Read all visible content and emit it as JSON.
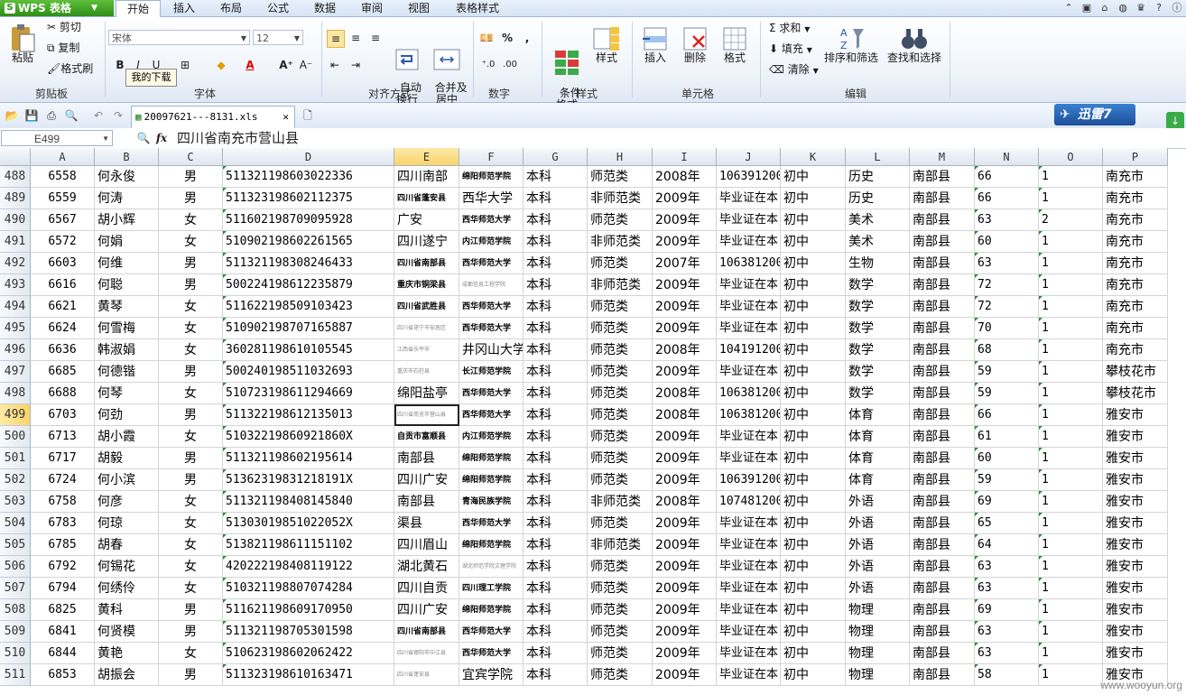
{
  "app": {
    "name": "WPS 表格"
  },
  "tabs": [
    "开始",
    "插入",
    "布局",
    "公式",
    "数据",
    "审阅",
    "视图",
    "表格样式"
  ],
  "ribbon": {
    "clipboard": {
      "paste": "粘贴",
      "cut": "剪切",
      "copy": "复制",
      "format_painter": "格式刷",
      "group": "剪贴板"
    },
    "font": {
      "name": "宋体",
      "size": "12",
      "group": "字体",
      "bold": "B",
      "italic": "I",
      "underline": "U",
      "grow": "A⁺",
      "shrink": "A⁻",
      "color_label": "A"
    },
    "align": {
      "wrap": "自动\n换行",
      "merge": "合并及\n居中",
      "group": "对齐方式"
    },
    "number": {
      "percent": "%",
      "comma": ",",
      "inc": "⁺.0",
      "dec": ".00",
      "group": "数字"
    },
    "styles": {
      "cond": "条件\n格式",
      "style": "样式",
      "group": "样式"
    },
    "cells": {
      "insert": "插入",
      "delete": "删除",
      "format": "格式",
      "group": "单元格"
    },
    "edit": {
      "sum": "求和",
      "fill": "填充",
      "clear": "清除",
      "sort": "排序和筛选",
      "find": "查找和选择",
      "group": "编辑"
    },
    "tooltip": "我的下载"
  },
  "doc": {
    "filename": "20097621---8131.xls"
  },
  "xunlei": "迅雷7",
  "formula": {
    "cell": "E499",
    "value": "四川省南充市营山县"
  },
  "columns": [
    "A",
    "B",
    "C",
    "D",
    "E",
    "F",
    "G",
    "H",
    "I",
    "J",
    "K",
    "L",
    "M",
    "N",
    "O",
    "P"
  ],
  "selected": {
    "row": 499,
    "col": "E"
  },
  "rows": [
    {
      "n": "488",
      "a": "6558",
      "b": "何永俊",
      "c": "男",
      "d": "511321198603022336",
      "e": "四川南部",
      "es": "n",
      "f": "绵阳师范学院",
      "fs": "t",
      "g": "本科",
      "h": "师范类",
      "i": "2008年",
      "j": "106391200",
      "k": "初中",
      "l": "历史",
      "m": "南部县",
      "nn": "66",
      "o": "1",
      "p": "南充市"
    },
    {
      "n": "489",
      "a": "6559",
      "b": "何涛",
      "c": "男",
      "d": "511323198602112375",
      "e": "四川省蓬安县",
      "es": "t",
      "f": "西华大学",
      "fs": "n",
      "g": "本科",
      "h": "非师范类",
      "i": "2009年",
      "j": "毕业证在本",
      "k": "初中",
      "l": "历史",
      "m": "南部县",
      "nn": "66",
      "o": "1",
      "p": "南充市"
    },
    {
      "n": "490",
      "a": "6567",
      "b": "胡小辉",
      "c": "女",
      "d": "511602198709095928",
      "e": "广安",
      "es": "n",
      "f": "西华师范大学",
      "fs": "t",
      "g": "本科",
      "h": "师范类",
      "i": "2009年",
      "j": "毕业证在本",
      "k": "初中",
      "l": "美术",
      "m": "南部县",
      "nn": "63",
      "o": "2",
      "p": "南充市"
    },
    {
      "n": "491",
      "a": "6572",
      "b": "何娟",
      "c": "女",
      "d": "510902198602261565",
      "e": "四川遂宁",
      "es": "n",
      "f": "内江师范学院",
      "fs": "t",
      "g": "本科",
      "h": "非师范类",
      "i": "2009年",
      "j": "毕业证在本",
      "k": "初中",
      "l": "美术",
      "m": "南部县",
      "nn": "60",
      "o": "1",
      "p": "南充市"
    },
    {
      "n": "492",
      "a": "6603",
      "b": "何维",
      "c": "男",
      "d": "511321198308246433",
      "e": "四川省南部县",
      "es": "t",
      "f": "西华师范大学",
      "fs": "t",
      "g": "本科",
      "h": "师范类",
      "i": "2007年",
      "j": "106381200",
      "k": "初中",
      "l": "生物",
      "m": "南部县",
      "nn": "63",
      "o": "1",
      "p": "南充市"
    },
    {
      "n": "493",
      "a": "6616",
      "b": "何聪",
      "c": "男",
      "d": "500224198612235879",
      "e": "重庆市铜梁县",
      "es": "t",
      "f": "成都信息工程学院",
      "fs": "g",
      "g": "本科",
      "h": "非师范类",
      "i": "2009年",
      "j": "毕业证在本",
      "k": "初中",
      "l": "数学",
      "m": "南部县",
      "nn": "72",
      "o": "1",
      "p": "南充市"
    },
    {
      "n": "494",
      "a": "6621",
      "b": "黄琴",
      "c": "女",
      "d": "511622198509103423",
      "e": "四川省武胜县",
      "es": "t",
      "f": "西华师范大学",
      "fs": "t",
      "g": "本科",
      "h": "师范类",
      "i": "2009年",
      "j": "毕业证在本",
      "k": "初中",
      "l": "数学",
      "m": "南部县",
      "nn": "72",
      "o": "1",
      "p": "南充市"
    },
    {
      "n": "495",
      "a": "6624",
      "b": "何雪梅",
      "c": "女",
      "d": "510902198707165887",
      "e": "四川省遂宁市安居区",
      "es": "g",
      "f": "西华师范大学",
      "fs": "t",
      "g": "本科",
      "h": "师范类",
      "i": "2009年",
      "j": "毕业证在本",
      "k": "初中",
      "l": "数学",
      "m": "南部县",
      "nn": "70",
      "o": "1",
      "p": "南充市"
    },
    {
      "n": "496",
      "a": "6636",
      "b": "韩淑娟",
      "c": "女",
      "d": "360281198610105545",
      "e": "江西省乐平市",
      "es": "g",
      "f": "井冈山大学",
      "fs": "n",
      "g": "本科",
      "h": "师范类",
      "i": "2008年",
      "j": "104191200",
      "k": "初中",
      "l": "数学",
      "m": "南部县",
      "nn": "68",
      "o": "1",
      "p": "南充市"
    },
    {
      "n": "497",
      "a": "6685",
      "b": "何德锴",
      "c": "男",
      "d": "500240198511032693",
      "e": "重庆市石柱县",
      "es": "g",
      "f": "长江师范学院",
      "fs": "t",
      "g": "本科",
      "h": "师范类",
      "i": "2009年",
      "j": "毕业证在本",
      "k": "初中",
      "l": "数学",
      "m": "南部县",
      "nn": "59",
      "o": "1",
      "p": "攀枝花市"
    },
    {
      "n": "498",
      "a": "6688",
      "b": "何琴",
      "c": "女",
      "d": "510723198611294669",
      "e": "绵阳盐亭",
      "es": "n",
      "f": "西华师范大学",
      "fs": "t",
      "g": "本科",
      "h": "师范类",
      "i": "2008年",
      "j": "106381200",
      "k": "初中",
      "l": "数学",
      "m": "南部县",
      "nn": "59",
      "o": "1",
      "p": "攀枝花市"
    },
    {
      "n": "499",
      "a": "6703",
      "b": "何劲",
      "c": "男",
      "d": "511322198612135013",
      "e": "四川省南充市营山县",
      "es": "g",
      "f": "西华师范大学",
      "fs": "t",
      "g": "本科",
      "h": "师范类",
      "i": "2008年",
      "j": "106381200",
      "k": "初中",
      "l": "体育",
      "m": "南部县",
      "nn": "66",
      "o": "1",
      "p": "雅安市"
    },
    {
      "n": "500",
      "a": "6713",
      "b": "胡小霞",
      "c": "女",
      "d": "51032219860921860X",
      "e": "自贡市富顺县",
      "es": "t",
      "f": "内江师范学院",
      "fs": "t",
      "g": "本科",
      "h": "师范类",
      "i": "2009年",
      "j": "毕业证在本",
      "k": "初中",
      "l": "体育",
      "m": "南部县",
      "nn": "61",
      "o": "1",
      "p": "雅安市"
    },
    {
      "n": "501",
      "a": "6717",
      "b": "胡毅",
      "c": "男",
      "d": "511321198602195614",
      "e": "南部县",
      "es": "n",
      "f": "绵阳师范学院",
      "fs": "t",
      "g": "本科",
      "h": "师范类",
      "i": "2009年",
      "j": "毕业证在本",
      "k": "初中",
      "l": "体育",
      "m": "南部县",
      "nn": "60",
      "o": "1",
      "p": "雅安市"
    },
    {
      "n": "502",
      "a": "6724",
      "b": "何小滨",
      "c": "男",
      "d": "51362319831218191X",
      "e": "四川广安",
      "es": "n",
      "f": "绵阳师范学院",
      "fs": "t",
      "g": "本科",
      "h": "师范类",
      "i": "2009年",
      "j": "106391200",
      "k": "初中",
      "l": "体育",
      "m": "南部县",
      "nn": "59",
      "o": "1",
      "p": "雅安市"
    },
    {
      "n": "503",
      "a": "6758",
      "b": "何彦",
      "c": "女",
      "d": "511321198408145840",
      "e": "南部县",
      "es": "n",
      "f": "青海民族学院",
      "fs": "t",
      "g": "本科",
      "h": "非师范类",
      "i": "2008年",
      "j": "107481200",
      "k": "初中",
      "l": "外语",
      "m": "南部县",
      "nn": "69",
      "o": "1",
      "p": "雅安市"
    },
    {
      "n": "504",
      "a": "6783",
      "b": "何琼",
      "c": "女",
      "d": "51303019851022052X",
      "e": "渠县",
      "es": "n",
      "f": "西华师范大学",
      "fs": "t",
      "g": "本科",
      "h": "师范类",
      "i": "2009年",
      "j": "毕业证在本",
      "k": "初中",
      "l": "外语",
      "m": "南部县",
      "nn": "65",
      "o": "1",
      "p": "雅安市"
    },
    {
      "n": "505",
      "a": "6785",
      "b": "胡春",
      "c": "女",
      "d": "513821198611151102",
      "e": "四川眉山",
      "es": "n",
      "f": "绵阳师范学院",
      "fs": "t",
      "g": "本科",
      "h": "非师范类",
      "i": "2009年",
      "j": "毕业证在本",
      "k": "初中",
      "l": "外语",
      "m": "南部县",
      "nn": "64",
      "o": "1",
      "p": "雅安市"
    },
    {
      "n": "506",
      "a": "6792",
      "b": "何锡花",
      "c": "女",
      "d": "420222198408119122",
      "e": "湖北黄石",
      "es": "n",
      "f": "湖北师范学院文理学院",
      "fs": "g",
      "g": "本科",
      "h": "师范类",
      "i": "2009年",
      "j": "毕业证在本",
      "k": "初中",
      "l": "外语",
      "m": "南部县",
      "nn": "63",
      "o": "1",
      "p": "雅安市"
    },
    {
      "n": "507",
      "a": "6794",
      "b": "何绣伶",
      "c": "女",
      "d": "510321198807074284",
      "e": "四川自贡",
      "es": "n",
      "f": "四川理工学院",
      "fs": "t",
      "g": "本科",
      "h": "师范类",
      "i": "2009年",
      "j": "毕业证在本",
      "k": "初中",
      "l": "外语",
      "m": "南部县",
      "nn": "63",
      "o": "1",
      "p": "雅安市"
    },
    {
      "n": "508",
      "a": "6825",
      "b": "黄科",
      "c": "男",
      "d": "511621198609170950",
      "e": "四川广安",
      "es": "n",
      "f": "绵阳师范学院",
      "fs": "t",
      "g": "本科",
      "h": "师范类",
      "i": "2009年",
      "j": "毕业证在本",
      "k": "初中",
      "l": "物理",
      "m": "南部县",
      "nn": "69",
      "o": "1",
      "p": "雅安市"
    },
    {
      "n": "509",
      "a": "6841",
      "b": "何贤模",
      "c": "男",
      "d": "511321198705301598",
      "e": "四川省南部县",
      "es": "t",
      "f": "西华师范大学",
      "fs": "t",
      "g": "本科",
      "h": "师范类",
      "i": "2009年",
      "j": "毕业证在本",
      "k": "初中",
      "l": "物理",
      "m": "南部县",
      "nn": "63",
      "o": "1",
      "p": "雅安市"
    },
    {
      "n": "510",
      "a": "6844",
      "b": "黄艳",
      "c": "女",
      "d": "510623198602062422",
      "e": "四川省德阳市中江县",
      "es": "g",
      "f": "西华师范大学",
      "fs": "t",
      "g": "本科",
      "h": "师范类",
      "i": "2009年",
      "j": "毕业证在本",
      "k": "初中",
      "l": "物理",
      "m": "南部县",
      "nn": "63",
      "o": "1",
      "p": "雅安市"
    },
    {
      "n": "511",
      "a": "6853",
      "b": "胡振会",
      "c": "男",
      "d": "511323198610163471",
      "e": "四川省蓬安县",
      "es": "g",
      "f": "宜宾学院",
      "fs": "n",
      "g": "本科",
      "h": "师范类",
      "i": "2009年",
      "j": "毕业证在本",
      "k": "初中",
      "l": "物理",
      "m": "南部县",
      "nn": "58",
      "o": "1",
      "p": "雅安市"
    }
  ],
  "watermark": "www.wooyun.org"
}
